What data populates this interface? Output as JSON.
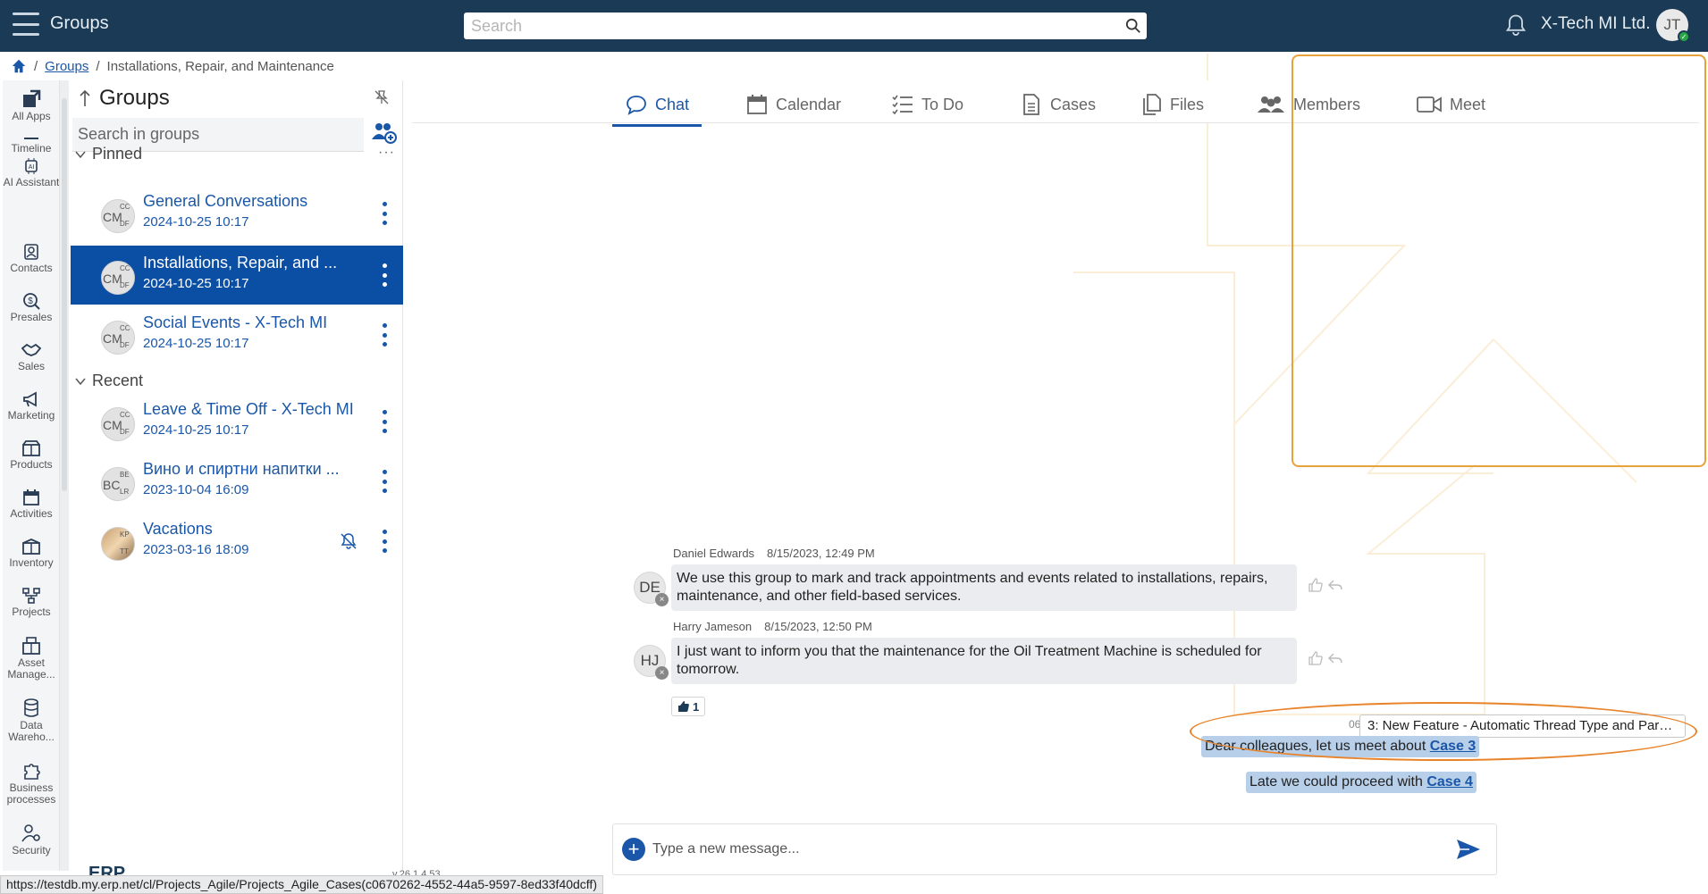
{
  "topbar": {
    "title": "Groups",
    "search_placeholder": "Search",
    "company": "X-Tech MI Ltd.",
    "user_initials": "JT",
    "online_mark": "✓",
    "icons": [
      "hamburger-icon",
      "search-icon",
      "bell-icon"
    ]
  },
  "breadcrumb": {
    "separator": "/",
    "link": "Groups",
    "current": "Installations, Repair, and Maintenance"
  },
  "leftnav": {
    "items": [
      {
        "label": "All Apps",
        "icon": "all-apps-icon"
      },
      {
        "label": "Timeline",
        "icon": "timeline-icon"
      },
      {
        "label": "AI Assistant",
        "icon": "ai-assistant-icon"
      },
      {
        "label": "Contacts",
        "icon": "contacts-icon"
      },
      {
        "label": "Presales",
        "icon": "presales-icon"
      },
      {
        "label": "Sales",
        "icon": "sales-icon"
      },
      {
        "label": "Marketing",
        "icon": "marketing-icon"
      },
      {
        "label": "Products",
        "icon": "products-icon"
      },
      {
        "label": "Activities",
        "icon": "activities-icon"
      },
      {
        "label": "Inventory",
        "icon": "inventory-icon"
      },
      {
        "label": "Projects",
        "icon": "projects-icon"
      },
      {
        "label": "Asset Manage...",
        "icon": "asset-management-icon"
      },
      {
        "label": "Data Wareho...",
        "icon": "data-warehouse-icon"
      },
      {
        "label": "Business processes",
        "icon": "business-processes-icon"
      },
      {
        "label": "Security",
        "icon": "security-icon"
      }
    ]
  },
  "groups": {
    "title": "Groups",
    "search_placeholder": "Search in groups",
    "pinned_label": "Pinned",
    "recent_label": "Recent",
    "more_label": "···",
    "pinned": [
      {
        "name": "General Conversations",
        "date": "2024-10-25 10:17",
        "avatar": [
          "CM",
          "CC",
          "DF"
        ]
      },
      {
        "name": "Installations, Repair, and ...",
        "date": "2024-10-25 10:17",
        "avatar": [
          "CM",
          "CC",
          "DF"
        ]
      },
      {
        "name": "Social Events - X-Tech MI",
        "date": "2024-10-25 10:17",
        "avatar": [
          "CM",
          "CC",
          "DF"
        ]
      }
    ],
    "recent": [
      {
        "name": "Leave & Time Off - X-Tech MI",
        "date": "2024-10-25 10:17",
        "avatar": [
          "CM",
          "CC",
          "DF"
        ]
      },
      {
        "name": "Вино и спиртни напитки ...",
        "date": "2023-10-04 16:09",
        "avatar": [
          "BC",
          "BE",
          "LR"
        ]
      },
      {
        "name": "Vacations",
        "date": "2023-03-16 18:09",
        "avatar": [
          "",
          "KP",
          "TT"
        ]
      }
    ],
    "footer_logo": "ERP",
    "footer_version": "v.26.1.4.53"
  },
  "tabs": [
    {
      "label": "Chat",
      "icon": "chat-icon",
      "active": true
    },
    {
      "label": "Calendar",
      "icon": "calendar-icon"
    },
    {
      "label": "To Do",
      "icon": "todo-icon"
    },
    {
      "label": "Cases",
      "icon": "cases-icon"
    },
    {
      "label": "Files",
      "icon": "files-icon"
    },
    {
      "label": "Members",
      "icon": "members-icon"
    },
    {
      "label": "Meet",
      "icon": "meet-icon"
    }
  ],
  "messages": [
    {
      "initials": "DE",
      "author": "Daniel Edwards",
      "time": "8/15/2023, 12:49 PM",
      "text": "We use this group to mark and track appointments and events related to installations, repairs, maintenance, and other field-based services."
    },
    {
      "initials": "HJ",
      "author": "Harry Jameson",
      "time": "8/15/2023, 12:50 PM",
      "text": "I just want to inform you that the maintenance for the Oil Treatment Machine is scheduled for tomorrow.",
      "reaction_count": "1"
    }
  ],
  "own_messages": [
    {
      "prefix": "Dear colleagues, let us meet about ",
      "link": "Case 3"
    },
    {
      "prefix": "Late we could proceed with ",
      "link": "Case 4"
    }
  ],
  "case_tooltip": "3: New Feature - Automatic Thread Type and Para...",
  "partial_time": "06",
  "composer": {
    "placeholder": "Type a new message..."
  },
  "statusbar": "https://testdb.my.erp.net/cl/Projects_Agile/Projects_Agile_Cases(c0670262-4552-44a5-9597-8ed33f40dcff)",
  "colors": {
    "topbar": "#1b3a55",
    "accent": "#1a57a8",
    "selected": "#0b4fa5",
    "highlight": "#e8832a"
  }
}
